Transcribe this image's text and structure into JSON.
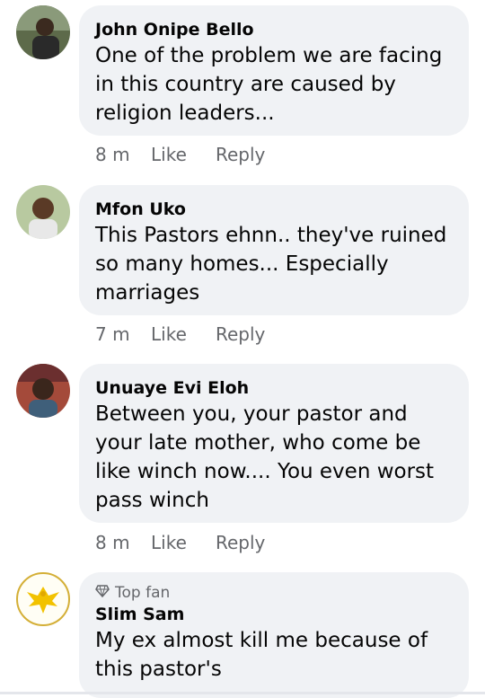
{
  "comments": [
    {
      "author": "John Onipe Bello",
      "text": "One of the problem we are facing in this country are caused by religion leaders...",
      "time": "8 m",
      "like": "Like",
      "reply": "Reply"
    },
    {
      "author": "Mfon Uko",
      "text": "This Pastors ehnn.. they've ruined so many homes... Especially marriages",
      "time": "7 m",
      "like": "Like",
      "reply": "Reply"
    },
    {
      "author": "Unuaye Evi Eloh",
      "text": "Between you, your pastor and your late mother, who come be like winch now.... You even worst pass winch",
      "time": "8 m",
      "like": "Like",
      "reply": "Reply"
    },
    {
      "badge": "Top fan",
      "author": "Slim Sam",
      "text": "My ex almost kill me because of this pastor's"
    }
  ],
  "icons": {
    "badge": "diamond-icon"
  },
  "colors": {
    "bubble": "#f0f2f5",
    "secondary_text": "#65676b",
    "avatar_ring_gold": "#d4af37"
  }
}
